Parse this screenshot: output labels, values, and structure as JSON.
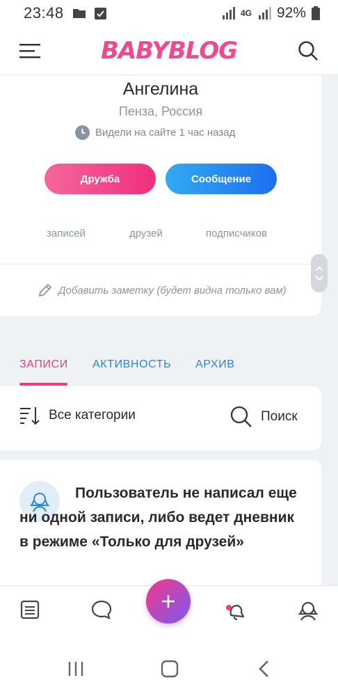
{
  "status_bar": {
    "time": "23:48",
    "network": "4G",
    "battery": "92%"
  },
  "header": {
    "logo": "BABYBLOG"
  },
  "profile": {
    "name": "Ангелина",
    "location": "Пенза, Россия",
    "last_seen": "Видели на сайте  1 час назад",
    "friend_button": "Дружба",
    "message_button": "Сообщение",
    "stats": {
      "posts_label": "записей",
      "friends_label": "друзей",
      "followers_label": "подписчиков"
    },
    "note_placeholder": "Добавить заметку (будет видна только вам)"
  },
  "tabs": [
    {
      "label": "ЗАПИСИ",
      "active": true
    },
    {
      "label": "АКТИВНОСТЬ",
      "active": false
    },
    {
      "label": "АРХИВ",
      "active": false
    }
  ],
  "filter": {
    "categories_label": "Все категории",
    "search_label": "Поиск"
  },
  "empty_state": {
    "message": "Пользователь не написал еще ни одной записи, либо ведет дневник в режиме «Только для друзей»"
  },
  "colors": {
    "brand_pink": "#ee3a82",
    "accent_blue": "#2b86d6"
  },
  "icons": {
    "nav": [
      "feed-icon",
      "chat-icon",
      "add-icon",
      "notifications-icon",
      "profile-icon"
    ]
  }
}
